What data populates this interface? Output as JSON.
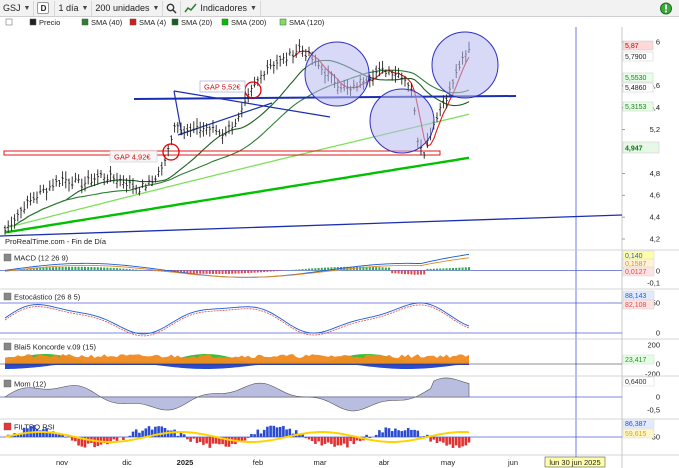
{
  "toolbar": {
    "symbol": "GSJ",
    "timeframe": "1 día",
    "units": "200 unidades",
    "indicators": "Indicadores",
    "draw_mode": "D",
    "icons": [
      "search-icon",
      "indicators-icon",
      "alert-icon",
      "close-icon"
    ]
  },
  "legend": {
    "price": "Precio",
    "sma40": "SMA (40)",
    "sma4": "SMA (4)",
    "sma20": "SMA (20)",
    "sma200": "SMA (200)",
    "sma120": "SMA (120)"
  },
  "colors": {
    "price": "#202020",
    "sma40": "#2e7d32",
    "sma4": "#d81b1b",
    "sma20": "#1b5e20",
    "sma200": "#00c000",
    "sma120": "#7ee05a",
    "trend": "#1a2fb0",
    "gap": "#e00000",
    "circle_fill": "#b8b8f0",
    "circle_stroke": "#3030c0",
    "macd_pos": "#2fa84f",
    "macd_neg": "#e04a4a"
  },
  "annotations": {
    "gap1": "GAP 5,52€",
    "gap2": "GAP 4,92€",
    "source": "ProRealTime.com - Fin de Día"
  },
  "price_axis": {
    "ticks": [
      "6",
      "5,6",
      "5,4",
      "5,2",
      "4,8",
      "4,6",
      "4,4",
      "4,2"
    ],
    "badges": [
      {
        "text": "5,87",
        "bg": "#ffd9d9",
        "fg": "#c00000"
      },
      {
        "text": "5,7900",
        "bg": "#ffffff",
        "fg": "#222222"
      },
      {
        "text": "5,5530",
        "bg": "#e6ffe6",
        "fg": "#1f7a1f"
      },
      {
        "text": "5,4860",
        "bg": "#ffffff",
        "fg": "#222222"
      },
      {
        "text": "5,3153",
        "bg": "#e6ffe6",
        "fg": "#1f7a1f"
      },
      {
        "text": "4,947",
        "bg": "#e8f8e8",
        "fg": "#0a7a0a"
      }
    ]
  },
  "panels": {
    "macd": {
      "title": "MACD (12 26 9)",
      "values": [
        "0,140",
        "0,1587",
        "0,0127"
      ],
      "ticks": [
        "0",
        "-0,1"
      ]
    },
    "stoch": {
      "title": "Estocástico (26 8 5)",
      "values": [
        "88,143",
        "82,108"
      ],
      "ticks": [
        "50",
        "0"
      ]
    },
    "koncorde": {
      "title": "Blai5 Koncorde v.09 (15)",
      "values": [
        "23,417"
      ],
      "ticks": [
        "200",
        "0",
        "-200"
      ]
    },
    "mom": {
      "title": "Mom (12)",
      "values": [
        "0,6400"
      ],
      "ticks": [
        "0",
        "-0,5"
      ]
    },
    "rsi": {
      "title": "FILTRO RSI",
      "values": [
        "86,387",
        "59,615"
      ],
      "ticks": [
        "50"
      ]
    }
  },
  "x_axis": {
    "labels": [
      "nov",
      "dic",
      "2025",
      "feb",
      "mar",
      "abr",
      "may",
      "jun"
    ],
    "cursor_label": "lun 30 jun 2025"
  }
}
